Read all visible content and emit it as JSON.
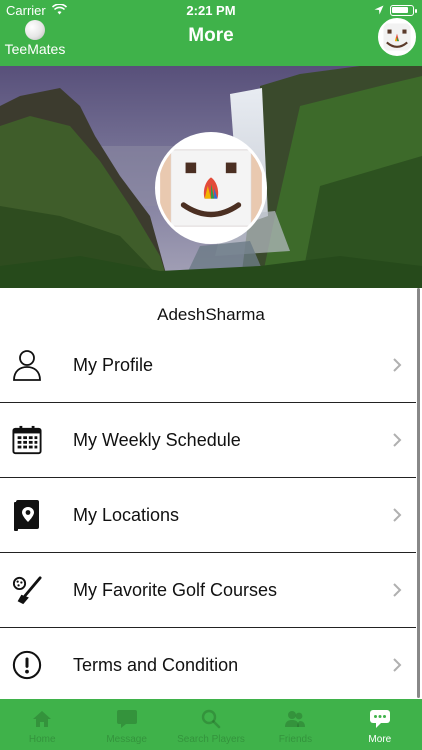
{
  "status_bar": {
    "carrier": "Carrier",
    "time": "2:21 PM",
    "battery_level": 0.85
  },
  "header": {
    "brand_label": "TeeMates",
    "title": "More",
    "color": "#3fb24a"
  },
  "profile": {
    "username": "AdeshSharma"
  },
  "menu": {
    "items": [
      {
        "label": "My Profile",
        "icon": "user-icon"
      },
      {
        "label": "My Weekly Schedule",
        "icon": "calendar-icon"
      },
      {
        "label": "My Locations",
        "icon": "location-book-icon"
      },
      {
        "label": "My Favorite Golf Courses",
        "icon": "golf-club-icon"
      },
      {
        "label": "Terms and Condition",
        "icon": "info-circle-icon"
      }
    ]
  },
  "tabbar": {
    "tabs": [
      {
        "label": "Home",
        "icon": "home-icon",
        "active": false
      },
      {
        "label": "Message",
        "icon": "message-icon",
        "active": false
      },
      {
        "label": "Search Players",
        "icon": "search-icon",
        "active": false
      },
      {
        "label": "Friends",
        "icon": "friends-icon",
        "active": false
      },
      {
        "label": "More",
        "icon": "more-chat-icon",
        "active": true
      }
    ]
  }
}
